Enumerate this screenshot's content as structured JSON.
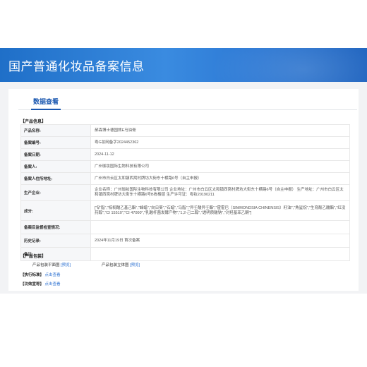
{
  "banner": {
    "title": "国产普通化妆品备案信息"
  },
  "tabs": [
    {
      "label": "数据查看"
    }
  ],
  "product_info": {
    "section_title": "【产品信息】",
    "rows": [
      {
        "label": "产品名称:",
        "value": "郝森博士德国熊E马油膏"
      },
      {
        "label": "备案编号:",
        "value": "粤G妆网备字2024452362"
      },
      {
        "label": "备案日期:",
        "value": "2024-11-12"
      },
      {
        "label": "备案人:",
        "value": "广州珈妆国际生物科技有限公司"
      },
      {
        "label": "备案人住所地址:",
        "value": "广州市白云区太和镇西窝村牌坊大街东十横路6号（自主申报）"
      },
      {
        "label": "生产企业:",
        "value": "企业名称：广州珈妆国际生物科技有限公司 企业地址：广州市白云区太和镇西窝村牌坊大街东十横路6号（自主申报） 生产地址：广州市白云区太和镇西窝村牌坊大街东十横路6号B栋楼层 生产许可证：粤妆20190211"
      },
      {
        "label": "成分:",
        "value": "[\"矿脂\",\"棕榈酸乙基己酯\",\"蜂蜡\",\"向日葵\",\"石蜡\",\"马脂\",\"异壬酸异壬酯\",\"霍霍巴（SIMMONDSIA CHINENSIS）籽油\",\"角鲨烷\",\"生育酚乙酸酯\",\"红没药醇\",\"CI 15510\",\"CI 47000\",\"乳酸杆菌发酵产物\",\"1,2-己二醇\",\"透明质酸钠\",\"对羟基苯乙酮\"]"
      },
      {
        "label": "备案后监督检查情况:",
        "value": ""
      },
      {
        "label": "历史记录:",
        "value": "2024年11月19日 首次备案"
      },
      {
        "label": "备注:",
        "value": ""
      }
    ]
  },
  "packaging": {
    "section_title": "【产品包装】",
    "flat_label": "产品包装平面图",
    "flat_link": "[预览]",
    "solid_label": "产品包装立体图",
    "solid_link": "[预览]"
  },
  "standard": {
    "label": "【执行标准】",
    "link": "点击查看"
  },
  "efficacy": {
    "label": "【功效宣称】",
    "link": "点击查看"
  },
  "colors": {
    "banner": "#2c78d4",
    "accent": "#1a57b0",
    "link": "#2a6fd1"
  }
}
